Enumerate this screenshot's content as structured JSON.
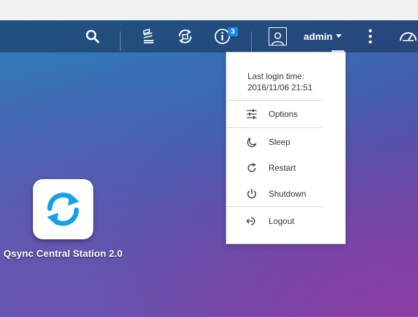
{
  "topbar": {
    "notification_count": "3",
    "user_name": "admin"
  },
  "user_menu": {
    "login_label": "Last login time:",
    "login_time": "2016/11/06 21:51",
    "items": [
      {
        "label": "Options",
        "icon": "sliders-icon"
      },
      {
        "label": "Sleep",
        "icon": "moon-icon"
      },
      {
        "label": "Restart",
        "icon": "restart-icon"
      },
      {
        "label": "Shutdown",
        "icon": "power-icon"
      },
      {
        "label": "Logout",
        "icon": "logout-icon"
      }
    ],
    "highlight_color": "#f7f74a"
  },
  "desktop": {
    "apps": [
      {
        "label": "Qsync Central Station 2.0",
        "icon": "qsync-sync-icon",
        "color": "#1a9fe0"
      }
    ]
  }
}
